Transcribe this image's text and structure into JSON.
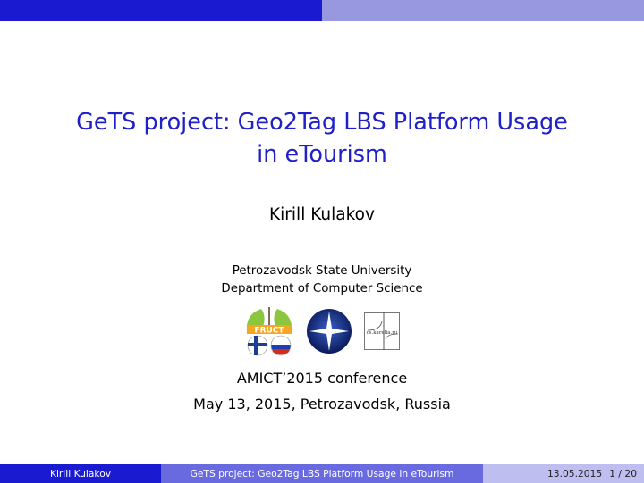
{
  "slide": {
    "title_line1": "GeTS project: Geo2Tag LBS Platform Usage",
    "title_line2": "in eTourism",
    "author": "Kirill Kulakov",
    "institute_line1": "Petrozavodsk State University",
    "institute_line2": "Department of Computer Science",
    "event_line1": "AMICT’2015 conference",
    "event_line2": "May 13, 2015, Petrozavodsk, Russia"
  },
  "logos": {
    "fruct_text": "FRUCT",
    "pk_text": "cs.karelia.ru"
  },
  "footer": {
    "author": "Kirill Kulakov",
    "title": "GeTS project: Geo2Tag LBS Platform Usage in eTourism",
    "date": "13.05.2015",
    "page": "1 / 20"
  },
  "colors": {
    "title": "#2020c8",
    "bar_dark": "#1a1ad0",
    "bar_mid": "#6a6ae0",
    "bar_light": "#bebef0"
  }
}
